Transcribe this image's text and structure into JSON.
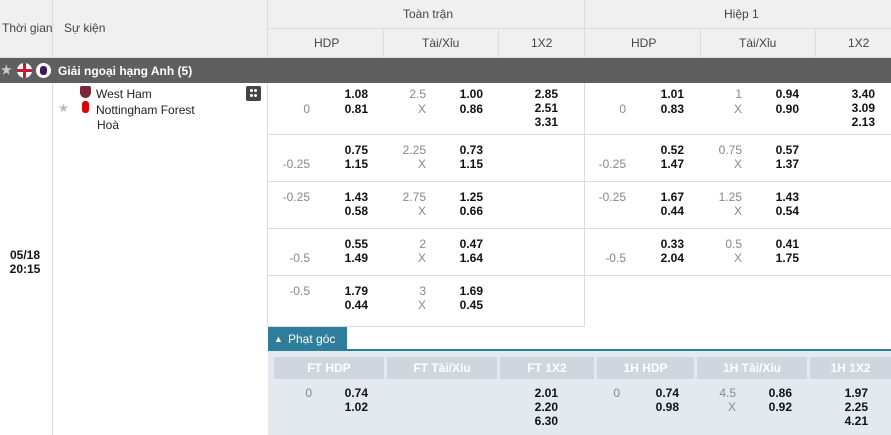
{
  "header": {
    "time_col": "Thời gian",
    "event_col": "Sự kiện",
    "full_match": "Toàn trận",
    "first_half": "Hiệp 1",
    "hdp": "HDP",
    "ou": "Tài/Xỉu",
    "x12": "1X2"
  },
  "league": {
    "name": "Giải ngoại hạng Anh (5)"
  },
  "match": {
    "date": "05/18",
    "time": "20:15",
    "home": "West Ham",
    "away": "Nottingham Forest",
    "draw": "Hoà"
  },
  "rows": [
    {
      "ft_hdp_line": "0",
      "ft_hdp_home": "1.08",
      "ft_hdp_away": "0.81",
      "ft_ou_line": "2.5",
      "ft_ou_x": "X",
      "ft_ou_over": "1.00",
      "ft_ou_under": "0.86",
      "ft_1": "2.85",
      "ft_2": "2.51",
      "ft_x": "3.31",
      "h1_hdp_line": "0",
      "h1_hdp_home": "1.01",
      "h1_hdp_away": "0.83",
      "h1_ou_line": "1",
      "h1_ou_x": "X",
      "h1_ou_over": "0.94",
      "h1_ou_under": "0.90",
      "h1_1": "3.40",
      "h1_2": "3.09",
      "h1_x": "2.13"
    },
    {
      "ft_hdp_line": "-0.25",
      "ft_hdp_home": "0.75",
      "ft_hdp_away": "1.15",
      "ft_ou_line": "2.25",
      "ft_ou_x": "X",
      "ft_ou_over": "0.73",
      "ft_ou_under": "1.15",
      "h1_hdp_line": "-0.25",
      "h1_hdp_home": "0.52",
      "h1_hdp_away": "1.47",
      "h1_ou_line": "0.75",
      "h1_ou_x": "X",
      "h1_ou_over": "0.57",
      "h1_ou_under": "1.37"
    },
    {
      "ft_hdp_line": "-0.25",
      "ft_hdp_home": "1.43",
      "ft_hdp_away": "0.58",
      "ft_ou_line": "2.75",
      "ft_ou_x": "X",
      "ft_ou_over": "1.25",
      "ft_ou_under": "0.66",
      "h1_hdp_line": "-0.25",
      "h1_hdp_home": "1.67",
      "h1_hdp_away": "0.44",
      "h1_ou_line": "1.25",
      "h1_ou_x": "X",
      "h1_ou_over": "1.43",
      "h1_ou_under": "0.54"
    },
    {
      "ft_hdp_line": "-0.5",
      "ft_hdp_home": "0.55",
      "ft_hdp_away": "1.49",
      "ft_ou_line": "2",
      "ft_ou_x": "X",
      "ft_ou_over": "0.47",
      "ft_ou_under": "1.64",
      "h1_hdp_line": "-0.5",
      "h1_hdp_home": "0.33",
      "h1_hdp_away": "2.04",
      "h1_ou_line": "0.5",
      "h1_ou_x": "X",
      "h1_ou_over": "0.41",
      "h1_ou_under": "1.75"
    },
    {
      "ft_hdp_line": "-0.5",
      "ft_hdp_home": "1.79",
      "ft_hdp_away": "0.44",
      "ft_ou_line": "3",
      "ft_ou_x": "X",
      "ft_ou_over": "1.69",
      "ft_ou_under": "0.45"
    }
  ],
  "corner": {
    "tab": "Phạt góc",
    "headers": [
      "FT HDP",
      "FT Tài/Xỉu",
      "FT 1X2",
      "1H HDP",
      "1H Tài/Xỉu",
      "1H 1X2"
    ],
    "ft_hdp_line": "0",
    "ft_hdp_home": "0.74",
    "ft_hdp_away": "1.02",
    "ft_1": "2.01",
    "ft_2": "2.20",
    "ft_x": "6.30",
    "h1_hdp_line": "0",
    "h1_hdp_home": "0.74",
    "h1_hdp_away": "0.98",
    "h1_ou_line": "4.5",
    "h1_ou_x": "X",
    "h1_ou_over": "0.86",
    "h1_ou_under": "0.92",
    "h1_1": "1.97",
    "h1_2": "2.25",
    "h1_x": "4.21"
  },
  "colors": {
    "league_bar": "#5f5f5f",
    "tab": "#2e7d9a",
    "corner_bg": "#e2eaf0",
    "header_bg": "#f0f0f0"
  }
}
